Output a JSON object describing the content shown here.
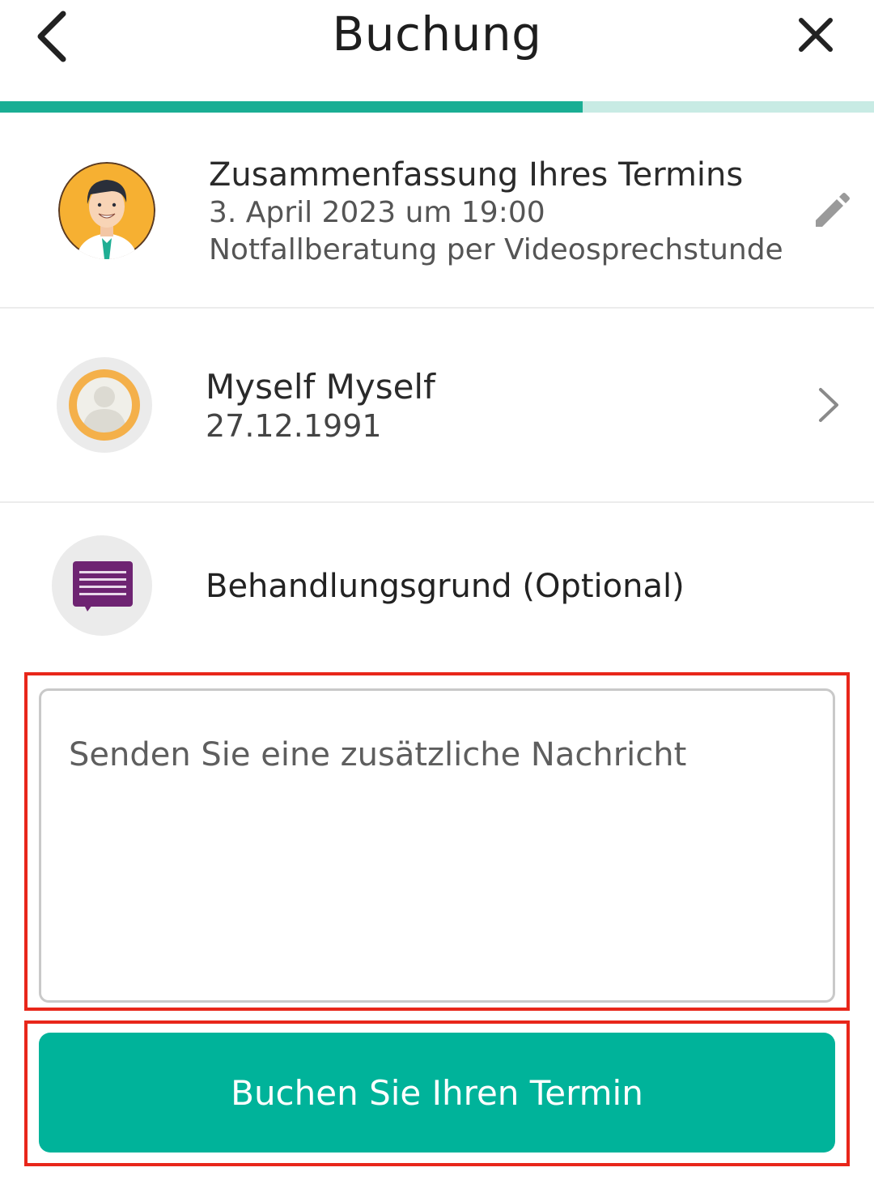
{
  "header": {
    "title": "Buchung",
    "back_icon": "chevron-left-icon",
    "close_icon": "close-icon"
  },
  "progress": {
    "value": 0.667,
    "fill_color": "#1aae94",
    "track_color": "#c8ebe4"
  },
  "summary": {
    "title": "Zusammenfassung Ihres Termins",
    "date": "3. April 2023 um 19:00",
    "service": "Notfallberatung per Videosprechstunde",
    "edit_icon": "pencil-icon"
  },
  "patient": {
    "name": "Myself Myself",
    "dob": "27.12.1991",
    "chevron_icon": "chevron-right-icon"
  },
  "reason": {
    "label": "Behandlungsgrund (Optional)",
    "icon": "message-icon"
  },
  "message": {
    "placeholder": "Senden Sie eine zusätzliche Nachricht",
    "value": ""
  },
  "book_button": {
    "label": "Buchen Sie Ihren Termin",
    "color": "#00b39a"
  },
  "highlight_color": "#e8261a"
}
